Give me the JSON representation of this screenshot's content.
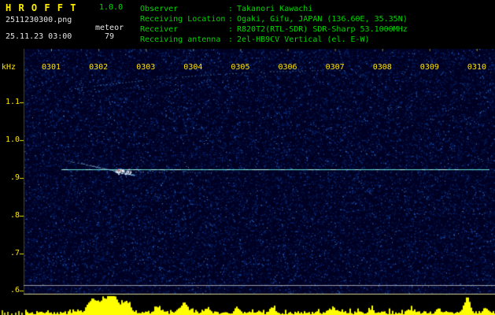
{
  "header": {
    "app_title": "H R O F F T",
    "version": "1.0.0",
    "filename": "2511230300.png",
    "mode": "meteor",
    "datetime": "25.11.23 03:00",
    "count": "79",
    "separator": ":",
    "info_rows": [
      {
        "label": "Observer",
        "value": "Takanori Kawachi"
      },
      {
        "label": "Receiving Location",
        "value": "Ogaki, Gifu, JAPAN (136.60E, 35.35N)"
      },
      {
        "label": "Receiver",
        "value": "R820T2(RTL-SDR) SDR-Sharp 53.1000MHz"
      },
      {
        "label": "Receiving antenna",
        "value": "2el-HB9CV Vertical (el. E-W)"
      }
    ]
  },
  "plot": {
    "y_axis_unit": "kHz",
    "freq_labels": [
      "1.1",
      "1.0",
      ".9",
      ".8",
      ".7",
      ".6"
    ],
    "time_labels": [
      "0301",
      "0302",
      "0303",
      "0304",
      "0305",
      "0306",
      "0307",
      "0308",
      "0309",
      "0310"
    ],
    "signal_annotations": {
      "carrier_line_khz": 0.92,
      "meteor_echo_time": "0302",
      "meteor_echo_khz": 0.93,
      "faint_aircraft_arc_span": "0301-0307",
      "activity_histogram_main_peaks": [
        "0302",
        "0304",
        "0310"
      ]
    }
  },
  "colors": {
    "label_yellow": "#ffe400",
    "header_green": "#00d400",
    "carrier_cyan": "#6ef0dc",
    "histogram_yellow": "#ffff00",
    "noise_blue": "#002268",
    "background": "#000000"
  }
}
